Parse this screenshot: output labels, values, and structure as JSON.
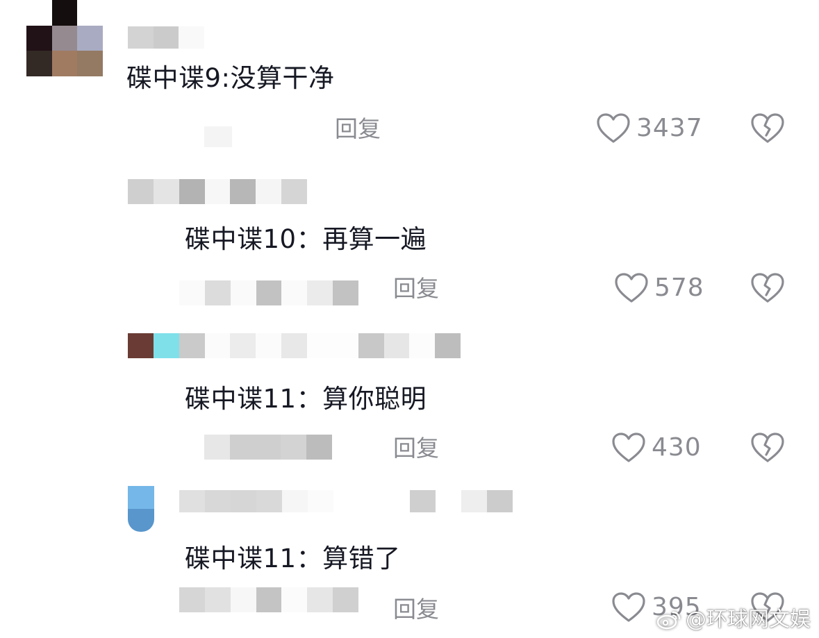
{
  "comments": [
    {
      "text": "碟中谍9:没算干净",
      "reply_label": "回复",
      "like_count": "3437",
      "icons": {
        "like": "heart-outline-icon",
        "dislike": "broken-heart-icon"
      }
    },
    {
      "text": "碟中谍10：再算一遍",
      "reply_label": "回复",
      "like_count": "578",
      "icons": {
        "like": "heart-outline-icon",
        "dislike": "broken-heart-icon"
      }
    },
    {
      "text": "碟中谍11：算你聪明",
      "reply_label": "回复",
      "like_count": "430",
      "icons": {
        "like": "heart-outline-icon",
        "dislike": "broken-heart-icon"
      }
    },
    {
      "text": "碟中谍11：算错了",
      "reply_label": "回复",
      "like_count": "395",
      "icons": {
        "like": "heart-outline-icon",
        "dislike": "broken-heart-icon"
      }
    }
  ],
  "watermark": {
    "text": "@环球网文娱",
    "icon": "weibo-logo-icon"
  },
  "colors": {
    "text": "#161823",
    "secondary": "#8a8b91",
    "background": "#ffffff"
  }
}
